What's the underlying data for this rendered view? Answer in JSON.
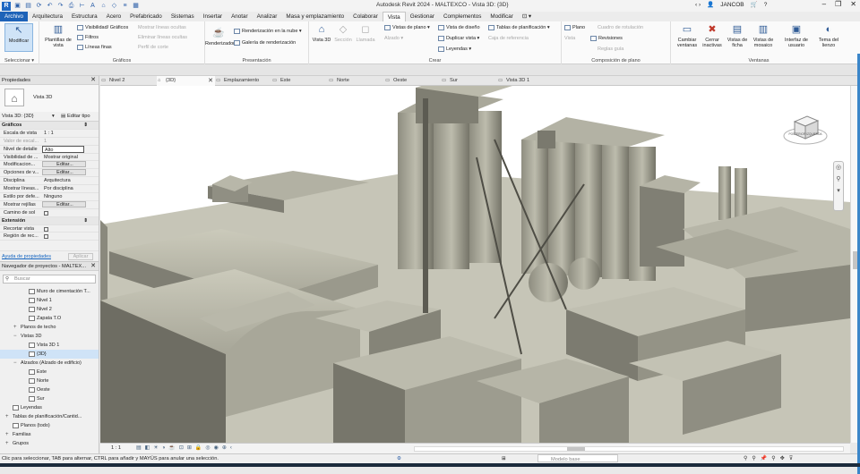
{
  "app": {
    "title": "Autodesk Revit 2024 - MALTEXCO - Vista 3D: {3D}",
    "user": "JANCOB"
  },
  "ribbon_tabs": [
    "Archivo",
    "Arquitectura",
    "Estructura",
    "Acero",
    "Prefabricado",
    "Sistemas",
    "Insertar",
    "Anotar",
    "Analizar",
    "Masa y emplazamiento",
    "Colaborar",
    "Vista",
    "Gestionar",
    "Complementos",
    "Modificar"
  ],
  "active_tab": "Vista",
  "ribbon": {
    "modify_label": "Modificar",
    "select_label": "Seleccionar ▾",
    "graphics": {
      "plantillas": "Plantillas de vista",
      "visibilidad": "Visibilidad/ Gráficos",
      "filtros": "Filtros",
      "lineas_finas": "Líneas finas",
      "mostrar_ocultas": "Mostrar líneas ocultas",
      "eliminar_ocultas": "Eliminar líneas ocultas",
      "perfil_corte": "Perfil de corte",
      "group_label": "Gráficos"
    },
    "presentation": {
      "renderizador": "Renderizador",
      "nube": "Renderización en la nube ▾",
      "galeria": "Galería de renderización",
      "group_label": "Presentación"
    },
    "create": {
      "vista3d": "Vista 3D",
      "seccion": "Sección",
      "llamada": "Llamada",
      "vistas_plano": "Vistas de plano ▾",
      "alzado": "Alzado ▾",
      "vista_diseno": "Vista de diseño",
      "duplicar": "Duplicar vista ▾",
      "leyendas": "Leyendas ▾",
      "tablas": "Tablas de planificación ▾",
      "caja_ref": "Caja de referencia",
      "group_label": "Crear"
    },
    "sheet": {
      "plano": "Plano",
      "vista": "Vista",
      "cuadro_rotulacion": "Cuadro de rotulación",
      "revisiones": "Revisiones",
      "reglas_guia": "Reglas guía",
      "group_label": "Composición de plano"
    },
    "windows": {
      "cambiar": "Cambiar ventanas",
      "cerrar": "Cerrar inactivas",
      "ficha": "Vistas de ficha",
      "mosaico": "Vistas de mosaico",
      "interfaz": "Interfaz de usuario",
      "tema": "Tema del lienzo",
      "group_label": "Ventanas"
    }
  },
  "properties": {
    "title": "Propiedades",
    "type_name": "Vista 3D",
    "type_selector": "Vista 3D: {3D}",
    "edit_type": "Editar tipo",
    "section_graficos": "Gráficos",
    "rows": [
      {
        "k": "Escala de vista",
        "v": "1 : 1"
      },
      {
        "k": "Valor de escal...",
        "v": "1",
        "dim": true
      },
      {
        "k": "Nivel de detalle",
        "v": "Alto"
      },
      {
        "k": "Visibilidad de ...",
        "v": "Mostrar original"
      },
      {
        "k": "Modificacion...",
        "v": "Editar..."
      },
      {
        "k": "Opciones de v...",
        "v": "Editar..."
      },
      {
        "k": "Disciplina",
        "v": "Arquitectura"
      },
      {
        "k": "Mostrar líneas...",
        "v": "Por disciplina"
      },
      {
        "k": "Estilo por defe...",
        "v": "Ninguno"
      },
      {
        "k": "Mostrar rejillas",
        "v": "Editar..."
      },
      {
        "k": "Camino de sol",
        "v": ""
      }
    ],
    "section_extension": "Extensión",
    "ext_rows": [
      {
        "k": "Recortar vista",
        "v": ""
      },
      {
        "k": "Región de rec...",
        "v": ""
      }
    ],
    "help_link": "Ayuda de propiedades",
    "apply": "Aplicar"
  },
  "browser": {
    "title": "Navegador de proyectos - MALTEX...",
    "search_placeholder": "Buscar",
    "items": [
      {
        "label": "Muro de cimentación T...",
        "level": 2
      },
      {
        "label": "Nivel 1",
        "level": 2
      },
      {
        "label": "Nivel 2",
        "level": 2
      },
      {
        "label": "Zapata T.O",
        "level": 2
      },
      {
        "label": "Planos de techo",
        "level": 1,
        "toggle": "+"
      },
      {
        "label": "Vistas 3D",
        "level": 1,
        "toggle": "−"
      },
      {
        "label": "Vista 3D 1",
        "level": 2
      },
      {
        "label": "{3D}",
        "level": 2,
        "selected": true
      },
      {
        "label": "Alzados (Alzado de edificio)",
        "level": 1,
        "toggle": "−"
      },
      {
        "label": "Este",
        "level": 2
      },
      {
        "label": "Norte",
        "level": 2
      },
      {
        "label": "Oeste",
        "level": 2
      },
      {
        "label": "Sur",
        "level": 2
      },
      {
        "label": "Leyendas",
        "level": 0
      },
      {
        "label": "Tablas de planificación/Cantid...",
        "level": 0,
        "toggle": "+"
      },
      {
        "label": "Planos (todo)",
        "level": 0
      },
      {
        "label": "Familias",
        "level": 0,
        "toggle": "+"
      },
      {
        "label": "Grupos",
        "level": 0,
        "toggle": "+"
      }
    ]
  },
  "view_tabs": [
    {
      "label": "Nivel 2",
      "active": false
    },
    {
      "label": "{3D}",
      "active": true
    },
    {
      "label": "Emplazamiento",
      "active": false
    },
    {
      "label": "Este",
      "active": false
    },
    {
      "label": "Norte",
      "active": false
    },
    {
      "label": "Oeste",
      "active": false
    },
    {
      "label": "Sur",
      "active": false
    },
    {
      "label": "Vista 3D 1",
      "active": false
    }
  ],
  "view_bar": {
    "scale": "1 : 1"
  },
  "viewcube_label": "POSTERIOR IZQUIERDA",
  "status": {
    "message": "Clic para seleccionar, TAB para alternar, CTRL para añadir y MAYÚS para anular una selección.",
    "model_base": "Modelo base"
  },
  "colors": {
    "file_tab": "#1e63b8",
    "model": "#b9b8a9"
  }
}
